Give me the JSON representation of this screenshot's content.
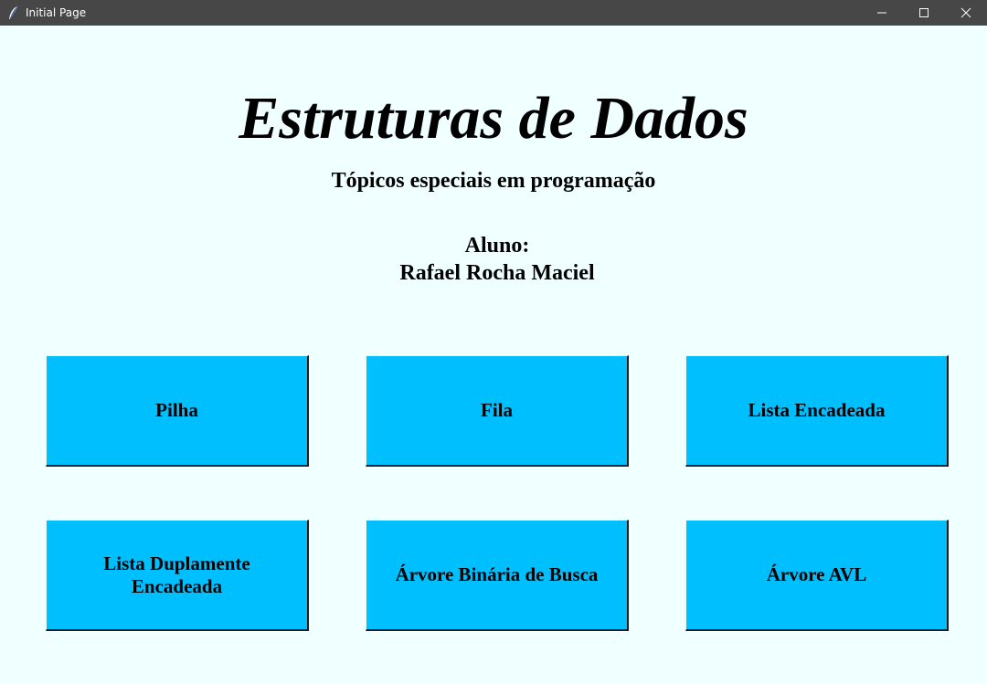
{
  "window": {
    "title": "Initial Page",
    "icon": "feather-icon",
    "controls": [
      "minimize-icon",
      "maximize-icon",
      "close-icon"
    ]
  },
  "main": {
    "heading": "Estruturas de Dados",
    "subtitle": "Tópicos especiais em programação",
    "student_label": "Aluno:",
    "student_name": "Rafael Rocha Maciel"
  },
  "buttons": [
    {
      "label": "Pilha"
    },
    {
      "label": "Fila"
    },
    {
      "label": "Lista Encadeada"
    },
    {
      "label": "Lista Duplamente\nEncadeada"
    },
    {
      "label": "Árvore Binária de Busca"
    },
    {
      "label": "Árvore AVL"
    }
  ],
  "colors": {
    "background": "#f0ffff",
    "button": "#00bfff",
    "titlebar": "#474747"
  }
}
